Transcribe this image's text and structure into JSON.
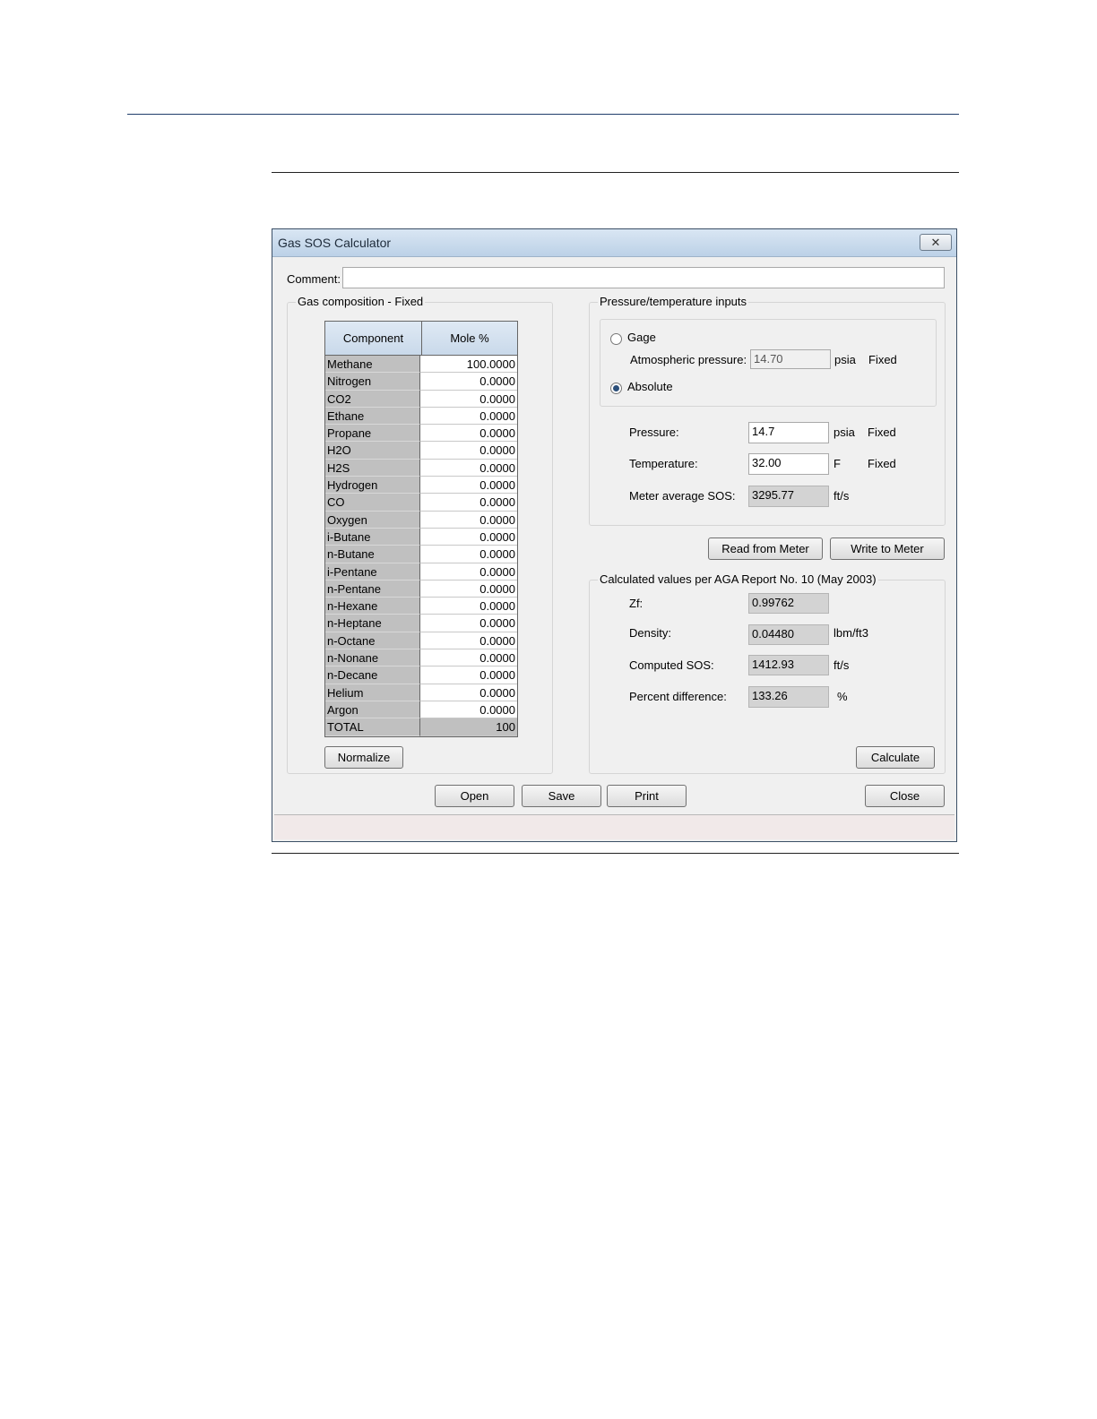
{
  "window": {
    "title": "Gas SOS Calculator",
    "close_glyph": "✕"
  },
  "comment": {
    "label": "Comment:",
    "value": ""
  },
  "gas": {
    "legend": "Gas composition - Fixed",
    "col_component": "Component",
    "col_mole": "Mole %",
    "rows": [
      {
        "name": "Methane",
        "value": "100.0000"
      },
      {
        "name": "Nitrogen",
        "value": "0.0000"
      },
      {
        "name": "CO2",
        "value": "0.0000"
      },
      {
        "name": "Ethane",
        "value": "0.0000"
      },
      {
        "name": "Propane",
        "value": "0.0000"
      },
      {
        "name": "H2O",
        "value": "0.0000"
      },
      {
        "name": "H2S",
        "value": "0.0000"
      },
      {
        "name": "Hydrogen",
        "value": "0.0000"
      },
      {
        "name": "CO",
        "value": "0.0000"
      },
      {
        "name": "Oxygen",
        "value": "0.0000"
      },
      {
        "name": "i-Butane",
        "value": "0.0000"
      },
      {
        "name": "n-Butane",
        "value": "0.0000"
      },
      {
        "name": "i-Pentane",
        "value": "0.0000"
      },
      {
        "name": "n-Pentane",
        "value": "0.0000"
      },
      {
        "name": "n-Hexane",
        "value": "0.0000"
      },
      {
        "name": "n-Heptane",
        "value": "0.0000"
      },
      {
        "name": "n-Octane",
        "value": "0.0000"
      },
      {
        "name": "n-Nonane",
        "value": "0.0000"
      },
      {
        "name": "n-Decane",
        "value": "0.0000"
      },
      {
        "name": "Helium",
        "value": "0.0000"
      },
      {
        "name": "Argon",
        "value": "0.0000"
      }
    ],
    "total": {
      "name": "TOTAL",
      "value": "100"
    },
    "normalize_label": "Normalize"
  },
  "pt": {
    "legend": "Pressure/temperature inputs",
    "gage_label": "Gage",
    "atm_label": "Atmospheric pressure:",
    "atm_value": "14.70",
    "atm_unit": "psia",
    "atm_mode": "Fixed",
    "absolute_label": "Absolute",
    "pressure_label": "Pressure:",
    "pressure_value": "14.7",
    "pressure_unit": "psia",
    "pressure_mode": "Fixed",
    "temp_label": "Temperature:",
    "temp_value": "32.00",
    "temp_unit": "F",
    "temp_mode": "Fixed",
    "sos_label": "Meter average SOS:",
    "sos_value": "3295.77",
    "sos_unit": "ft/s"
  },
  "meter_buttons": {
    "read": "Read from Meter",
    "write": "Write to Meter"
  },
  "calc": {
    "legend": "Calculated values per AGA Report No. 10 (May 2003)",
    "zf_label": "Zf:",
    "zf_value": "0.99762",
    "density_label": "Density:",
    "density_value": "0.04480",
    "density_unit": "lbm/ft3",
    "csos_label": "Computed SOS:",
    "csos_value": "1412.93",
    "csos_unit": "ft/s",
    "pct_label": "Percent difference:",
    "pct_value": "133.26",
    "pct_unit": "%",
    "calculate_label": "Calculate"
  },
  "footer": {
    "open": "Open",
    "save": "Save",
    "print": "Print",
    "close": "Close"
  }
}
